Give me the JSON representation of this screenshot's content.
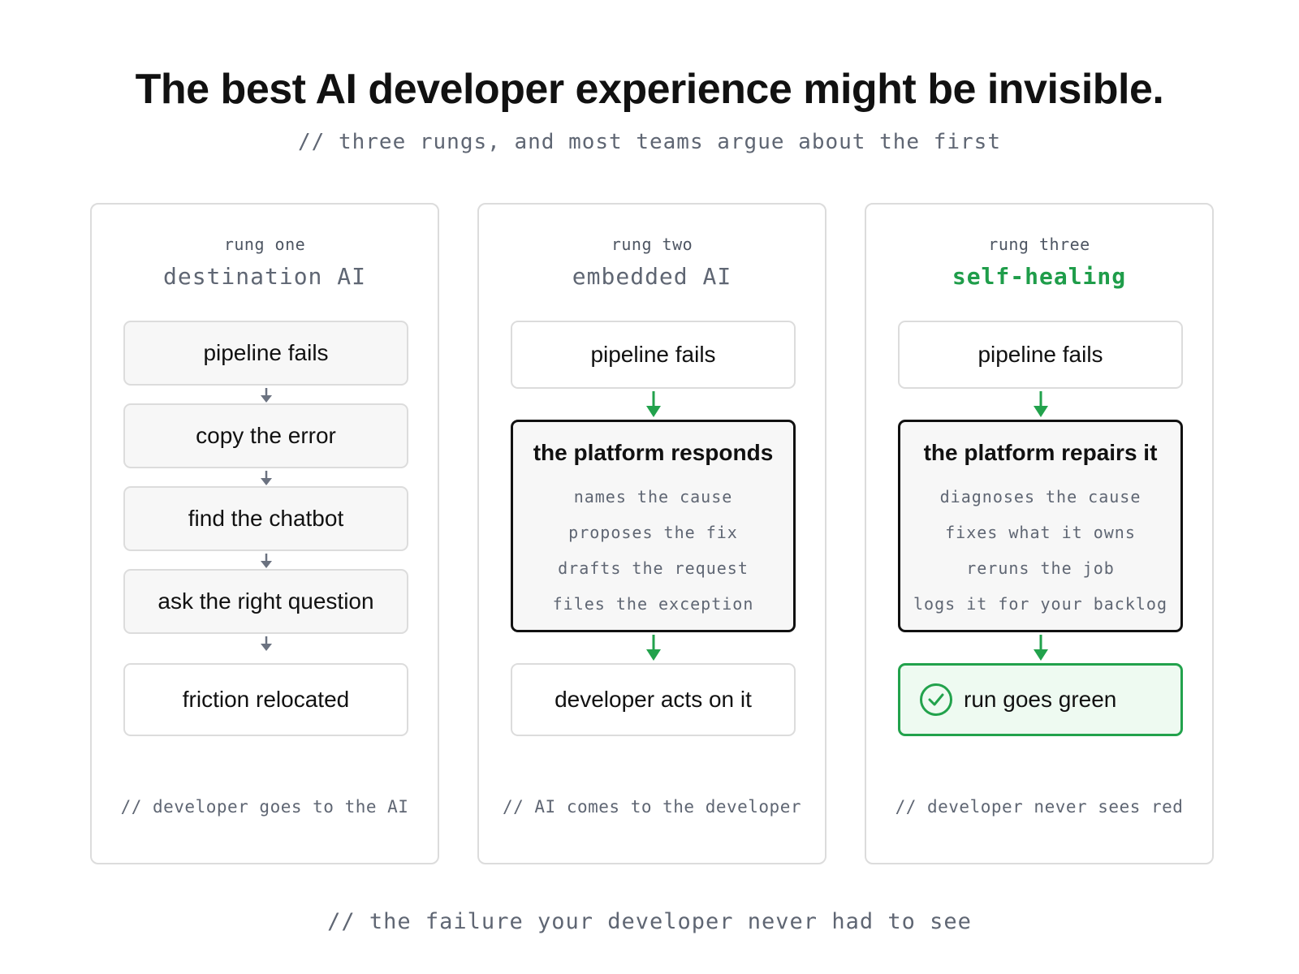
{
  "title": "The best AI developer experience might be invisible.",
  "subtitle": "// three rungs, and most teams argue about the first",
  "footer": "// the failure your developer never had to see",
  "colors": {
    "accent_green": "#22a24c",
    "arrow_gray": "#6b7280",
    "text_gray": "#5f6673"
  },
  "panels": [
    {
      "label": "rung one",
      "name": "destination AI",
      "steps": [
        "pipeline fails",
        "copy the error",
        "find the chatbot",
        "ask the right question"
      ],
      "outcome": "friction relocated",
      "caption": "// developer goes to the AI"
    },
    {
      "label": "rung two",
      "name": "embedded AI",
      "start": "pipeline fails",
      "core_title": "the platform responds",
      "core_details": [
        "names the cause",
        "proposes the fix",
        "drafts the request",
        "files the exception"
      ],
      "outcome": "developer acts on it",
      "caption": "// AI comes to the developer"
    },
    {
      "label": "rung three",
      "name": "self-healing",
      "start": "pipeline fails",
      "core_title": "the platform repairs it",
      "core_details": [
        "diagnoses the cause",
        "fixes what it owns",
        "reruns the job",
        "logs it for your backlog"
      ],
      "outcome": "run goes green",
      "outcome_icon": "check-circle-icon",
      "caption": "// developer never sees red"
    }
  ]
}
